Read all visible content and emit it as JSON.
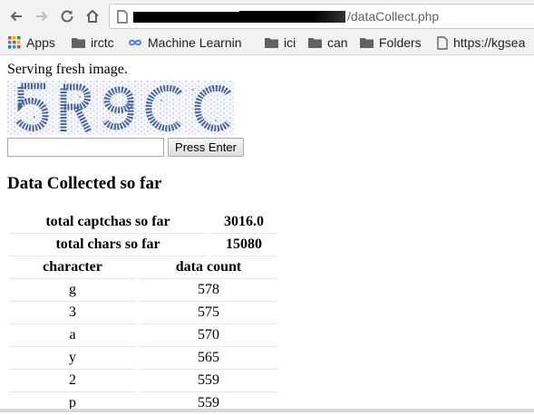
{
  "browser": {
    "url_path": "/dataCollect.php",
    "bookmarks": [
      {
        "label": "Apps",
        "icon": "apps-grid-icon"
      },
      {
        "label": "irctc",
        "icon": "folder-icon"
      },
      {
        "label": "Machine Learnin",
        "icon": "infinity-icon"
      },
      {
        "label": "ici",
        "icon": "folder-icon"
      },
      {
        "label": "can",
        "icon": "folder-icon"
      },
      {
        "label": "Folders",
        "icon": "folder-icon"
      },
      {
        "label": "https://kgsea",
        "icon": "page-icon"
      }
    ]
  },
  "page": {
    "status": "Serving fresh image.",
    "captcha_text": "5R9CC",
    "input_value": "",
    "submit_label": "Press Enter",
    "heading": "Data Collected so far",
    "summary": [
      {
        "label": "total captchas so far",
        "value": "3016.0"
      },
      {
        "label": "total chars so far",
        "value": "15080"
      }
    ],
    "table": {
      "headers": [
        "character",
        "data count"
      ],
      "rows": [
        {
          "char": "g",
          "count": "578"
        },
        {
          "char": "3",
          "count": "575"
        },
        {
          "char": "a",
          "count": "570"
        },
        {
          "char": "y",
          "count": "565"
        },
        {
          "char": "2",
          "count": "559"
        },
        {
          "char": "p",
          "count": "559"
        }
      ]
    }
  },
  "colors": {
    "chrome_bg": "#f2f2f2",
    "icon_gray": "#5f6368",
    "captcha_ink": "#2d4f8e"
  }
}
